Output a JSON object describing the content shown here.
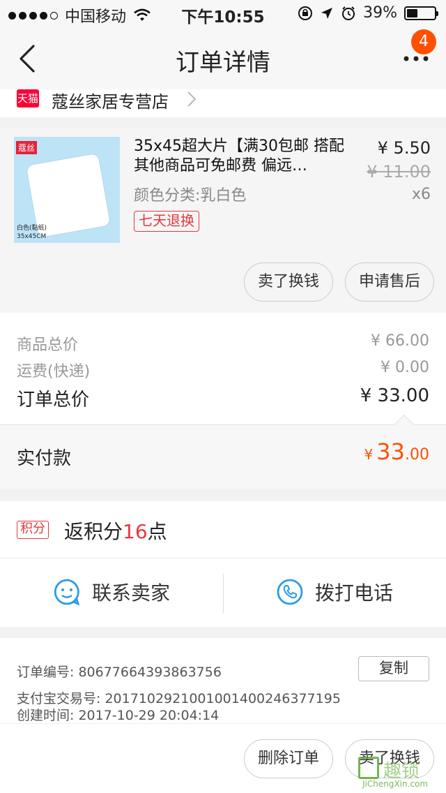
{
  "status_bar": {
    "carrier": "中国移动",
    "time": "下午10:55",
    "battery_text": "39%",
    "battery_level": 0.39
  },
  "nav": {
    "title": "订单详情",
    "badge": "4"
  },
  "shop": {
    "tag": "天猫",
    "name": "蔻丝家居专营店"
  },
  "item": {
    "brand": "蔻丝",
    "thumb_caption_1": "白色(黏纸)",
    "thumb_caption_2": "35x45CM",
    "title": "35x45超大片【满30包邮 搭配其他商品可免邮费 偏远…",
    "sku": "颜色分类:乳白色",
    "return_tag": "七天退换",
    "price": "¥ 5.50",
    "orig_price": "¥ 11.00",
    "qty": "x6",
    "btn_sell": "卖了换钱",
    "btn_after_sale": "申请售后"
  },
  "prices": {
    "goods_label": "商品总价",
    "goods_value": "¥ 66.00",
    "shipping_label": "运费(快递)",
    "shipping_value": "¥ 0.00",
    "total_label": "订单总价",
    "total_value": "¥ 33.00",
    "paid_label": "实付款",
    "paid_symbol": "¥",
    "paid_int": "33",
    "paid_dec": ".00"
  },
  "points": {
    "tag": "积分",
    "prefix": "返积分",
    "num": "16",
    "suffix": "点"
  },
  "contact": {
    "seller": "联系卖家",
    "call": "拨打电话"
  },
  "info": {
    "order_no": "订单编号:   80677664393863756",
    "alipay_no": "支付宝交易号:   2017102921001001400246377195",
    "created": "创建时间:   2017-10-29 20:04:14",
    "copy": "复制"
  },
  "bottom": {
    "delete": "删除订单",
    "sell": "卖了换钱"
  },
  "watermark": {
    "text": "趣锁",
    "url": "JiChengXin.com"
  }
}
